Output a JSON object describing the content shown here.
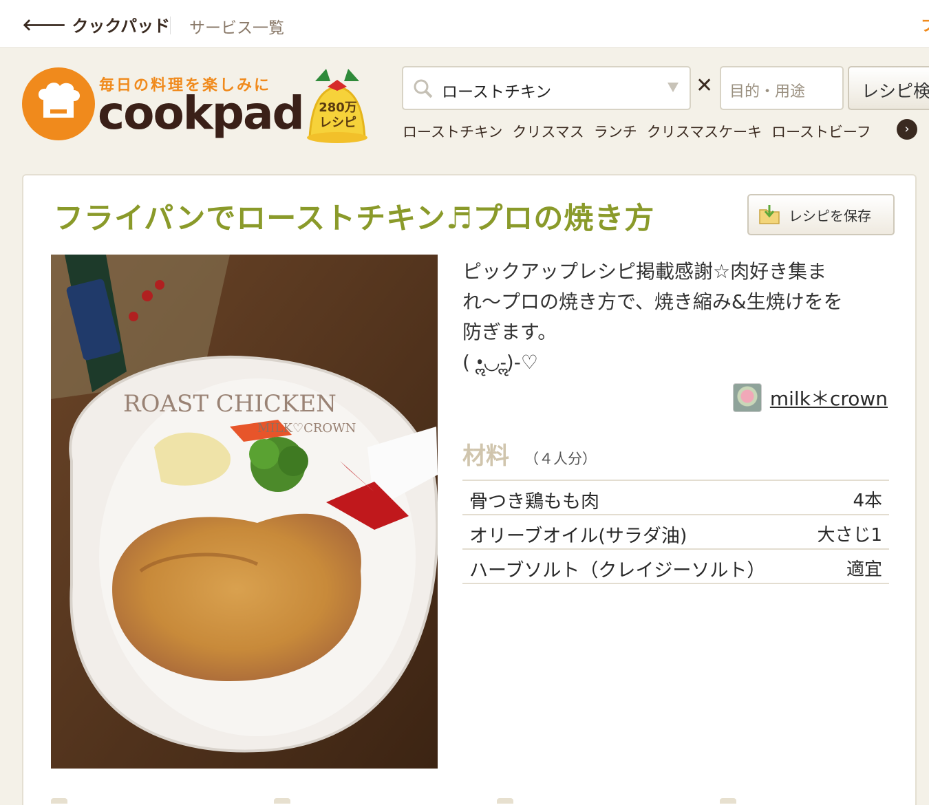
{
  "topbar": {
    "back_label": "クックパッド",
    "services_label": "サービス一覧"
  },
  "logo": {
    "tagline": "毎日の料理を楽しみに",
    "wordmark": "cookpad",
    "badge_line1": "280万",
    "badge_line2": "レシピ"
  },
  "search": {
    "query": "ローストチキン",
    "purpose_placeholder": "目的・用途",
    "button_label": "レシピ検索"
  },
  "keywords": [
    "ローストチキン",
    "クリスマス",
    "ランチ",
    "クリスマスケーキ",
    "ローストビーフ"
  ],
  "recipe": {
    "title": "フライパンでローストチキン♬プロの焼き方",
    "save_label": "レシピを保存",
    "photo_caption_1": "ROAST CHICKEN",
    "photo_caption_2": "MILK♡CROWN",
    "description_1": "ピックアップレシピ掲載感謝☆肉好き集ま",
    "description_2": "れ〜プロの焼き方で、焼き縮み&生焼けをを",
    "description_3": "防ぎます。",
    "description_4": "( •ॢ◡-ॢ)-♡",
    "author": "milk＊crown"
  },
  "ingredients": {
    "title": "材料",
    "servings": "（４人分）",
    "items": [
      {
        "name": "骨つき鶏もも肉",
        "qty": "4本"
      },
      {
        "name": "オリーブオイル(サラダ油)",
        "qty": "大さじ1"
      },
      {
        "name": "ハーブソルト（クレイジーソルト）",
        "qty": "適宜"
      }
    ]
  },
  "colors": {
    "brand_orange": "#f08a1c",
    "title_green": "#8a9a2a",
    "page_bg": "#f4f1e8"
  }
}
